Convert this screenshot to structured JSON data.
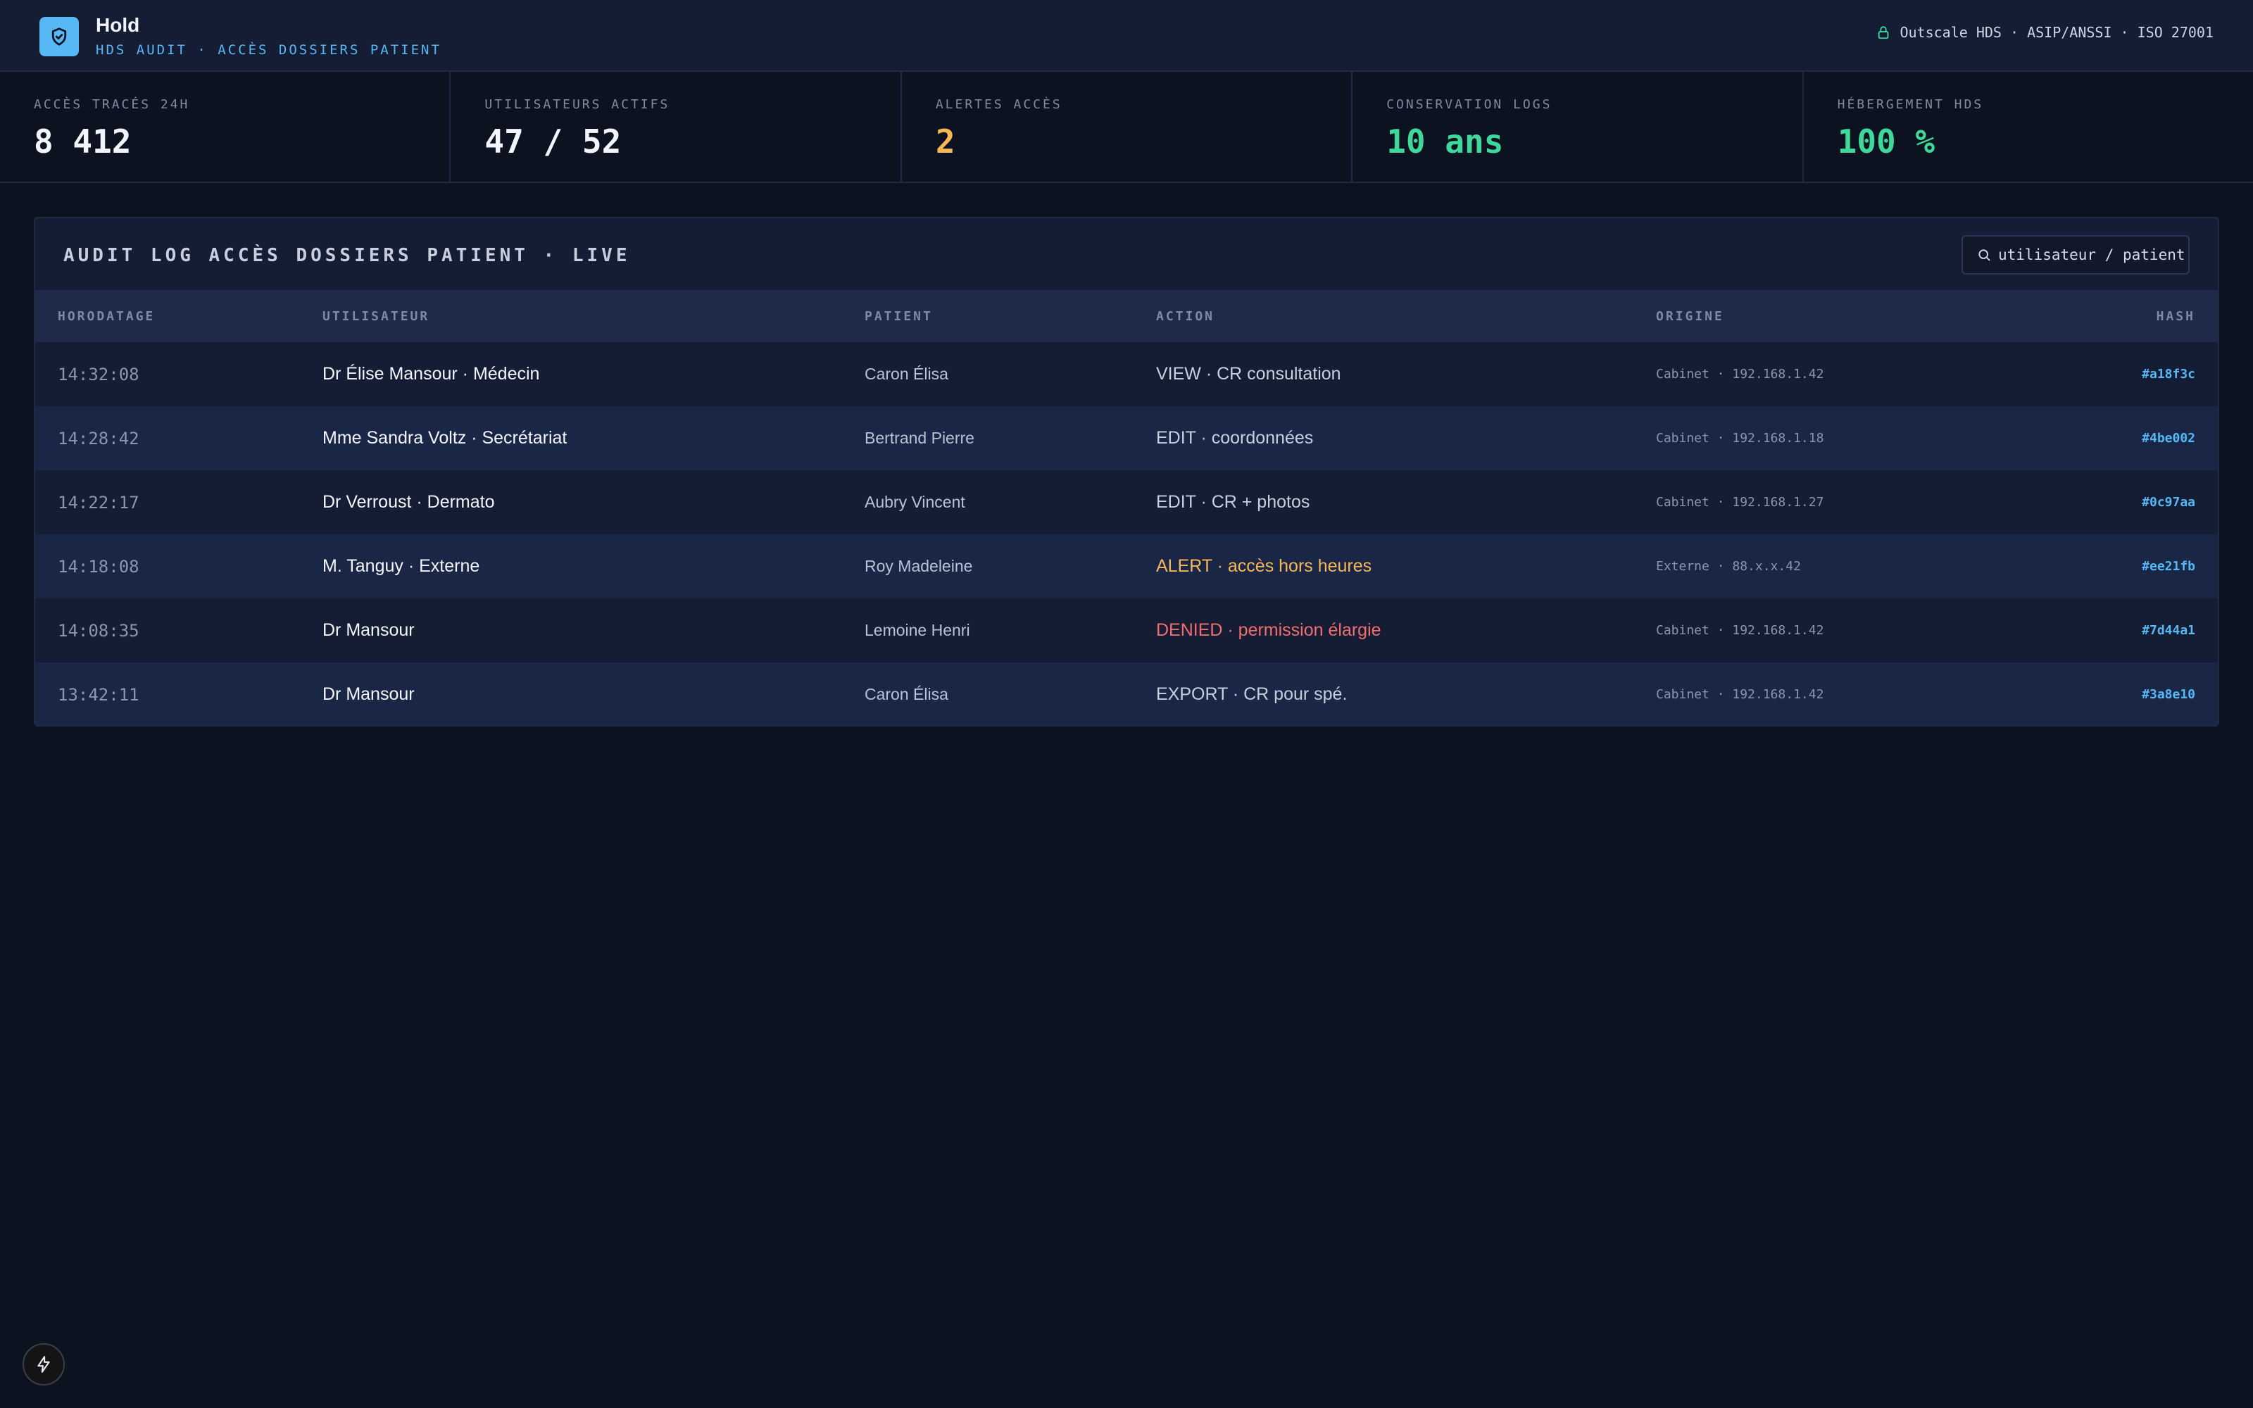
{
  "header": {
    "app_name": "Hold",
    "subtitle": "HDS AUDIT · ACCÈS DOSSIERS PATIENT",
    "compliance": "Outscale HDS · ASIP/ANSSI · ISO 27001"
  },
  "stats": [
    {
      "label": "Accès tracés 24h",
      "value": "8 412",
      "color": "#f2f5fb"
    },
    {
      "label": "Utilisateurs actifs",
      "value": "47 / 52",
      "color": "#f2f5fb"
    },
    {
      "label": "Alertes accès",
      "value": "2",
      "color": "#f6b756"
    },
    {
      "label": "Conservation logs",
      "value": "10 ans",
      "color": "#3ed89a"
    },
    {
      "label": "Hébergement HDS",
      "value": "100 %",
      "color": "#3ed89a"
    }
  ],
  "panel": {
    "title": "AUDIT LOG ACCÈS DOSSIERS PATIENT · LIVE",
    "search_value": "utilisateur / patient",
    "columns": [
      "Horodatage",
      "Utilisateur",
      "Patient",
      "Action",
      "Origine",
      "Hash"
    ],
    "rows": [
      {
        "time": "14:32:08",
        "user": "Dr Élise Mansour · Médecin",
        "patient": "Caron Élisa",
        "action": "VIEW · CR consultation",
        "status": "normal",
        "origin": "Cabinet · 192.168.1.42",
        "hash": "#a18f3c"
      },
      {
        "time": "14:28:42",
        "user": "Mme Sandra Voltz · Secrétariat",
        "patient": "Bertrand Pierre",
        "action": "EDIT · coordonnées",
        "status": "normal",
        "origin": "Cabinet · 192.168.1.18",
        "hash": "#4be002"
      },
      {
        "time": "14:22:17",
        "user": "Dr Verroust · Dermato",
        "patient": "Aubry Vincent",
        "action": "EDIT · CR + photos",
        "status": "normal",
        "origin": "Cabinet · 192.168.1.27",
        "hash": "#0c97aa"
      },
      {
        "time": "14:18:08",
        "user": "M. Tanguy · Externe",
        "patient": "Roy Madeleine",
        "action": "ALERT · accès hors heures",
        "status": "alert",
        "origin": "Externe · 88.x.x.42",
        "hash": "#ee21fb"
      },
      {
        "time": "14:08:35",
        "user": "Dr Mansour",
        "patient": "Lemoine Henri",
        "action": "DENIED · permission élargie",
        "status": "denied",
        "origin": "Cabinet · 192.168.1.42",
        "hash": "#7d44a1"
      },
      {
        "time": "13:42:11",
        "user": "Dr Mansour",
        "patient": "Caron Élisa",
        "action": "EXPORT · CR pour spé.",
        "status": "normal",
        "origin": "Cabinet · 192.168.1.42",
        "hash": "#3a8e10"
      }
    ]
  },
  "icons": {
    "logo": "shield-check-icon",
    "compliance": "lock-icon",
    "search": "search-icon",
    "floating": "bolt-icon"
  },
  "colors": {
    "accent": "#57b8f5",
    "success": "#3ed89a",
    "warning": "#f6b756",
    "danger": "#f26d6d"
  }
}
